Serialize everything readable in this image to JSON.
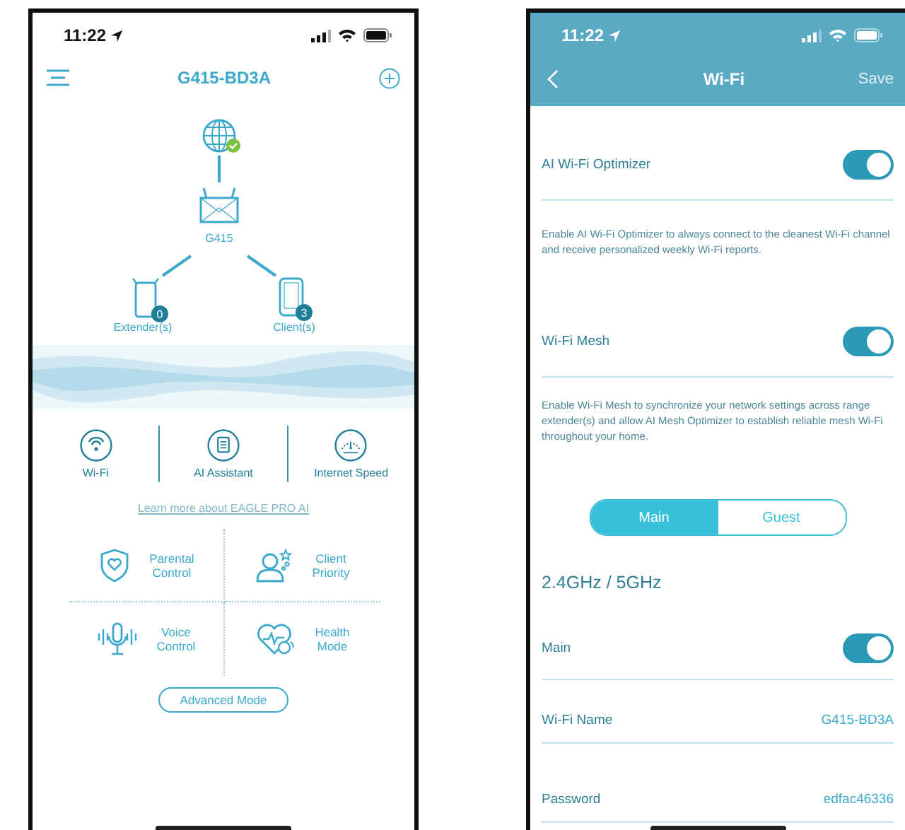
{
  "home_screen": {
    "status_bar": {
      "time": "11:22"
    },
    "title": "G415-BD3A",
    "topology": {
      "internet_connected": true,
      "router_label": "G415",
      "extenders": {
        "label": "Extender(s)",
        "count": "0"
      },
      "clients": {
        "label": "Client(s)",
        "count": "3"
      }
    },
    "features": [
      {
        "label": "Wi-Fi"
      },
      {
        "label": "AI Assistant"
      },
      {
        "label": "Internet Speed"
      }
    ],
    "link": "Learn more about EAGLE PRO AI",
    "tiles": [
      {
        "label": "Parental Control"
      },
      {
        "label": "Client Priority"
      },
      {
        "label": "Voice Control"
      },
      {
        "label": "Health Mode"
      }
    ],
    "advanced_button": "Advanced Mode"
  },
  "wifi_screen": {
    "status_bar": {
      "time": "11:22"
    },
    "title": "Wi-Fi",
    "save_button": {
      "label": "Save",
      "disabled": true
    },
    "options": [
      {
        "label": "AI Wi-Fi Optimizer",
        "on": true,
        "description": "Enable AI Wi-Fi Optimizer to always connect to the cleanest Wi-Fi channel and receive personalized weekly Wi-Fi reports."
      },
      {
        "label": "Wi-Fi Mesh",
        "on": true,
        "description": "Enable Wi-Fi Mesh to synchronize your network settings across range extender(s) and allow AI Mesh Optimizer to establish reliable mesh Wi-Fi throughout your home."
      }
    ],
    "tabs": [
      {
        "label": "Main",
        "selected": true
      },
      {
        "label": "Guest",
        "selected": false
      }
    ],
    "band_heading": "2.4GHz / 5GHz",
    "main_toggle": {
      "label": "Main",
      "on": true
    },
    "fields": [
      {
        "label": "Wi-Fi Name",
        "value": "G415-BD3A"
      },
      {
        "label": "Password",
        "value": "edfac46336"
      }
    ]
  }
}
